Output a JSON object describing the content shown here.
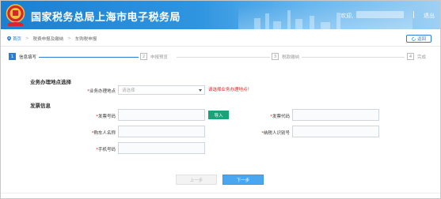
{
  "header": {
    "title": "国家税务总局上海市电子税务局",
    "welcome": "欢迎,",
    "logout": "退出"
  },
  "breadcrumb": {
    "items": [
      "首页",
      "税费申报及缴纳",
      "车购税申报"
    ],
    "back_label": "返回"
  },
  "steps": [
    {
      "number": "1",
      "label": "信息填写",
      "active": true
    },
    {
      "number": "2",
      "label": "申报预览",
      "active": false
    },
    {
      "number": "3",
      "label": "税款缴纳",
      "active": false
    },
    {
      "number": "4",
      "label": "完成",
      "active": false
    }
  ],
  "form": {
    "location_section_title": "业务办理地点选择",
    "location_label": "业务办理地点",
    "location_placeholder": "请选择",
    "location_error": "请选择业务办理地点！",
    "invoice_section_title": "发票信息",
    "invoice_number_label": "发票号码",
    "import_label": "导入",
    "invoice_code_label": "发票代码",
    "buyer_name_label": "购车人名称",
    "taxpayer_id_label": "纳税人识别号",
    "phone_label": "手机号码",
    "required_mark": "*"
  },
  "buttons": {
    "prev": "上一步",
    "next": "下一步"
  },
  "colors": {
    "primary": "#2b7dd8",
    "header_blue": "#1c7fd0",
    "error": "#e02020",
    "import_green": "#1aa37a",
    "next_blue": "#4aa6ee"
  }
}
